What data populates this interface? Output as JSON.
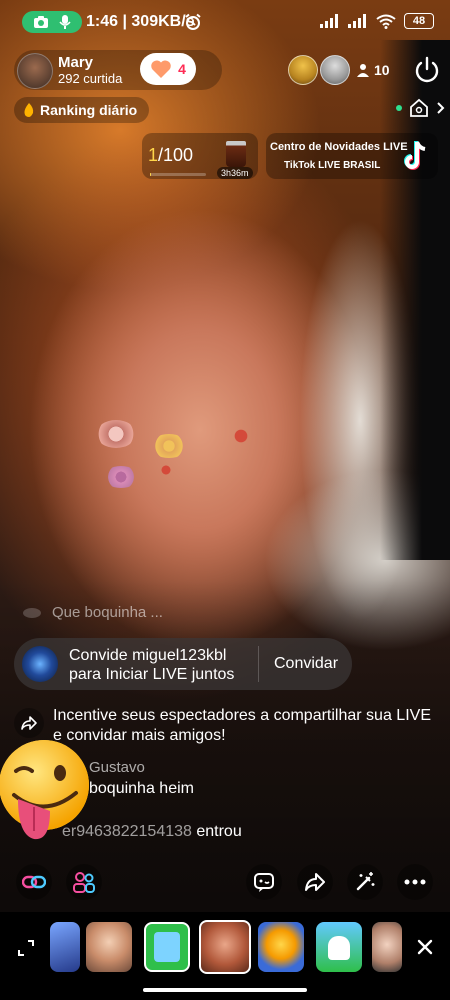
{
  "status_bar": {
    "time_speed": "1:46 | 309KB/s",
    "battery": "48"
  },
  "host": {
    "name": "Mary",
    "likes": "292 curtida",
    "follow_count": "4"
  },
  "viewers": {
    "count": "10"
  },
  "ranking": {
    "label": "Ranking diário"
  },
  "goal": {
    "progress": "1/100",
    "timer": "3h36m",
    "current": 1,
    "target": 100
  },
  "news": {
    "title": "Centro de Novidades LIVE",
    "subtitle": "TikTok LIVE BRASIL"
  },
  "chat": {
    "faded_comment": "Que boquinha ...",
    "invite_text_line1": "Convide miguel123kbl",
    "invite_text_line2": "para Iniciar LIVE juntos",
    "invite_button": "Convidar",
    "share_message": "Incentive seus espectadores a compartilhar sua LIVE e convidar mais amigos!",
    "comment_user": "Gustavo",
    "comment_text": "boquinha heim",
    "join_user": "er9463822154138",
    "join_text": " entrou"
  },
  "toolbar": {
    "left": [
      "link-icon",
      "people-icon"
    ],
    "right": [
      "comment-icon",
      "share-icon",
      "magic-wand-icon",
      "more-icon"
    ]
  },
  "colors": {
    "accent_red": "#fe2c55",
    "status_green": "#2fbf71",
    "goal_yellow": "#ffd64a"
  }
}
